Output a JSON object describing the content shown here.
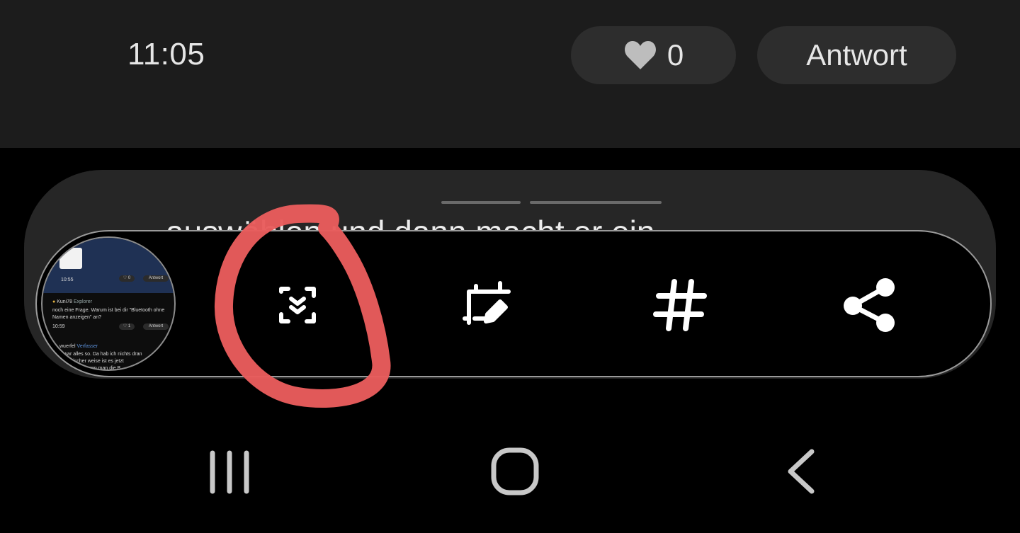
{
  "post": {
    "time": "11:05",
    "like_count": "0",
    "reply_label": "Antwort"
  },
  "card": {
    "text": "auswählen und dann macht er ein"
  },
  "thumbnail": {
    "time_1": "10:55",
    "like_1": "♡ 0",
    "reply_1": "Antwort",
    "author_1": "Kuni78",
    "role_1": "Explorer",
    "line_1": "noch eine Frage. Warum ist bei dir \"Bluetooth ohne",
    "line_2": "Namen anzeigen\" an?",
    "time_2": "10:59",
    "like_2": "♡ 1",
    "reply_2": "Antwort",
    "author_2": "wuerfel",
    "role_2": "Verfasser",
    "line_3": "war alles so. Da hab ich nichts dran",
    "line_4": "komischer weise ist es jetzt",
    "line_5": "wenn man die B"
  },
  "toolbar": {
    "icons": [
      "scroll-capture-icon",
      "crop-edit-icon",
      "hashtag-icon",
      "share-icon"
    ]
  },
  "nav": {
    "icons": [
      "recent-apps-icon",
      "home-icon",
      "back-icon"
    ]
  },
  "colors": {
    "accent_annotation": "#e85c5c",
    "post_bar": "#1c1c1c",
    "pill": "#2d2d2d"
  }
}
